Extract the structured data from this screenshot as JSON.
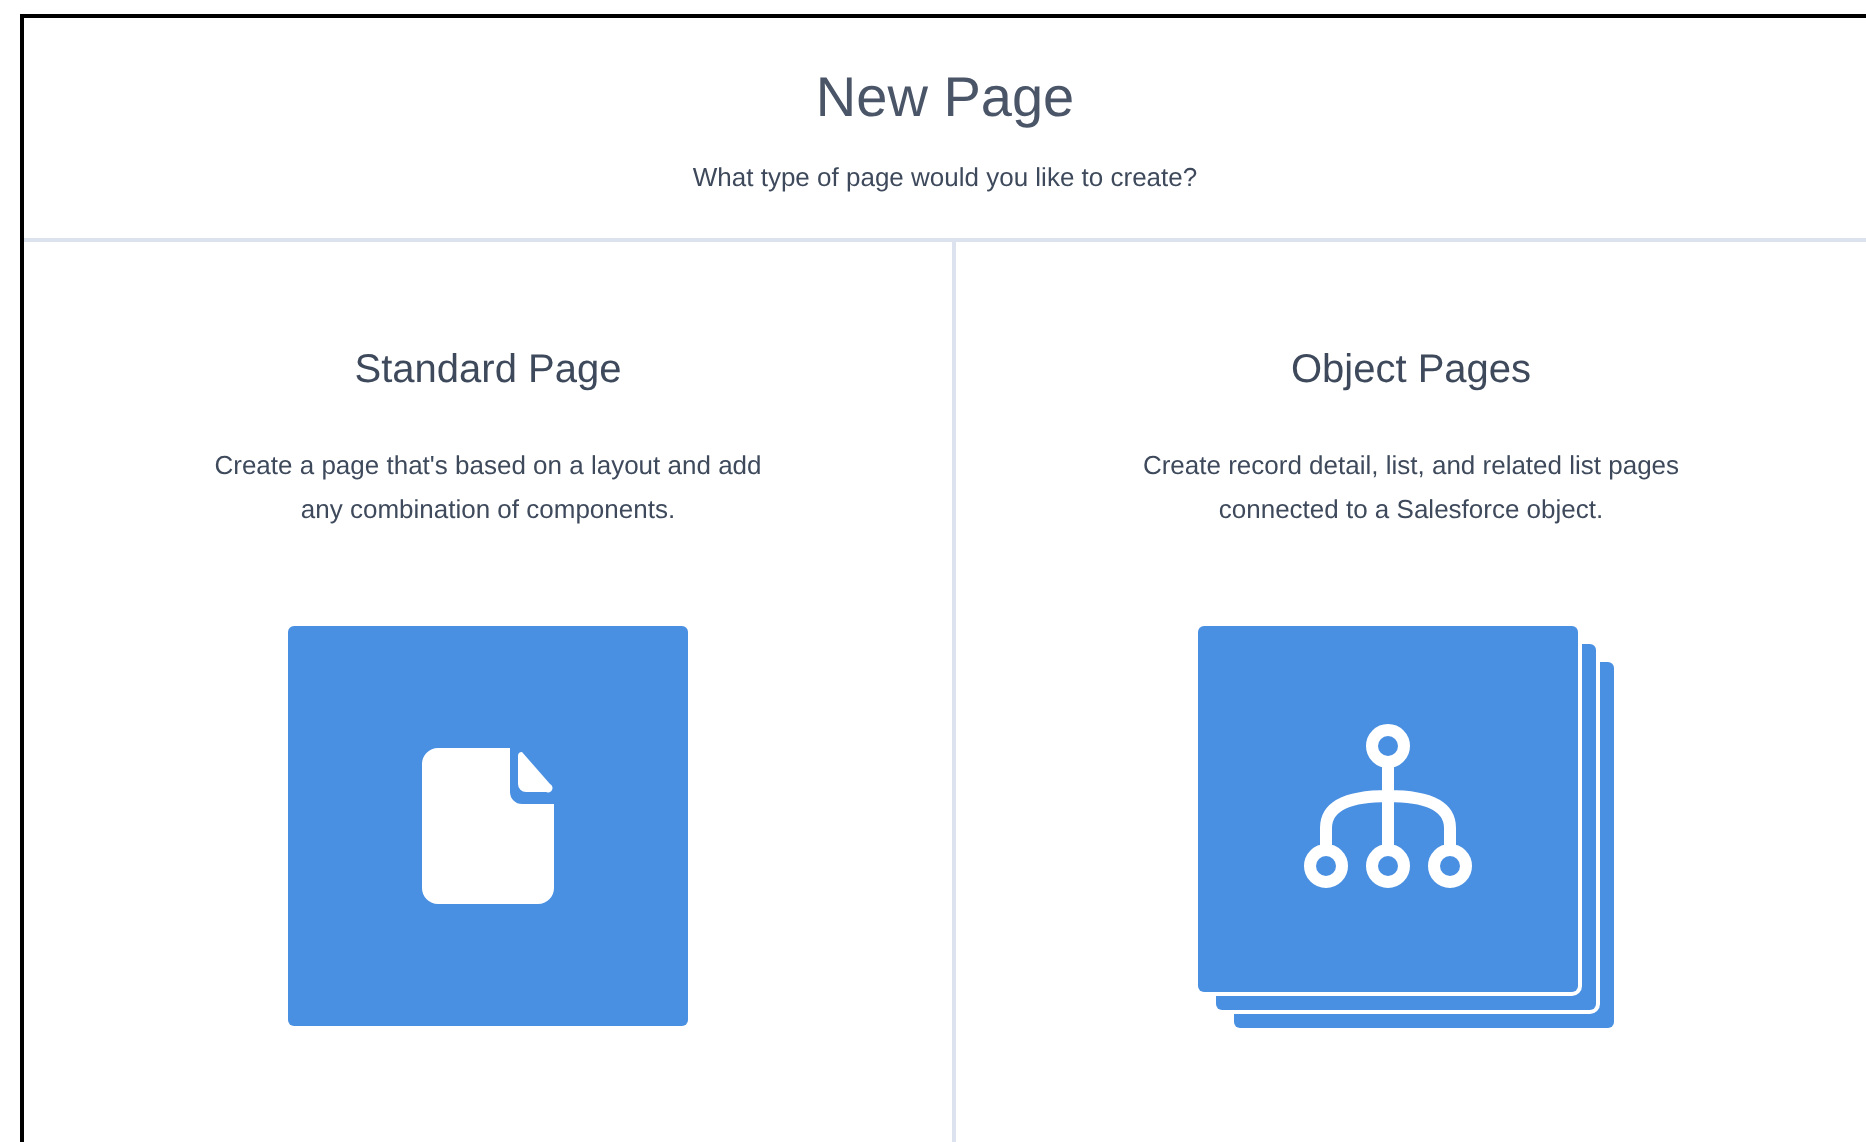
{
  "header": {
    "title": "New Page",
    "subtitle": "What type of page would you like to create?"
  },
  "options": [
    {
      "title": "Standard Page",
      "description": "Create a page that's based on a layout and add any combination of components.",
      "kind": "single"
    },
    {
      "title": "Object Pages",
      "description": "Create record detail, list, and related list pages connected to a Salesforce object.",
      "kind": "stacked"
    }
  ]
}
